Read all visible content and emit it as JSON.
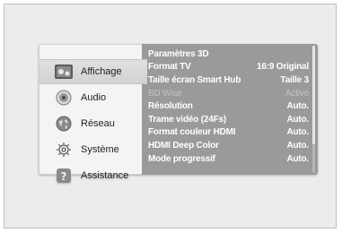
{
  "sidebar": {
    "items": [
      {
        "label": "Affichage",
        "icon": "display-settings-icon",
        "active": true
      },
      {
        "label": "Audio",
        "icon": "speaker-icon",
        "active": false
      },
      {
        "label": "Réseau",
        "icon": "globe-network-icon",
        "active": false
      },
      {
        "label": "Système",
        "icon": "gear-icon",
        "active": false
      },
      {
        "label": "Assistance",
        "icon": "help-icon",
        "active": false
      }
    ]
  },
  "settings": {
    "rows": [
      {
        "label": "Paramètres 3D",
        "value": "",
        "disabled": false
      },
      {
        "label": "Format TV",
        "value": "16:9 Original",
        "disabled": false
      },
      {
        "label": "Taille écran Smart Hub",
        "value": "Taille 3",
        "disabled": false
      },
      {
        "label": "BD Wise",
        "value": "Activé",
        "disabled": true
      },
      {
        "label": "Résolution",
        "value": "Auto.",
        "disabled": false
      },
      {
        "label": "Trame vidéo (24Fs)",
        "value": "Auto.",
        "disabled": false
      },
      {
        "label": "Format couleur HDMI",
        "value": "Auto.",
        "disabled": false
      },
      {
        "label": "HDMI Deep Color",
        "value": "Auto.",
        "disabled": false
      },
      {
        "label": "Mode progressif",
        "value": "Auto.",
        "disabled": false
      }
    ]
  }
}
